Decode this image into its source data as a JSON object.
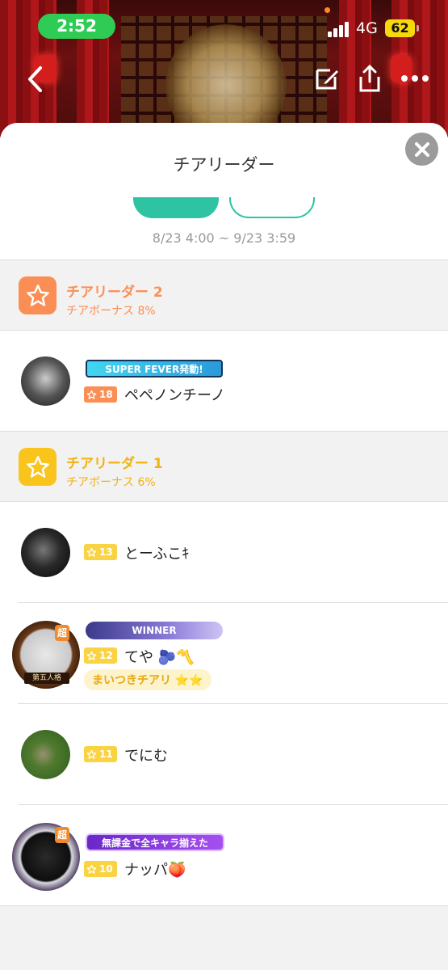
{
  "status_bar": {
    "time": "2:52",
    "network": "4G",
    "battery": "62"
  },
  "sheet": {
    "title": "チアリーダー",
    "tab_a_label": "",
    "tab_b_label": "",
    "period": "8/23 4:00 ~ 9/23 3:59"
  },
  "tiers": [
    {
      "name": "チアリーダー 2",
      "bonus": "チアボーナス 8%",
      "color": "#fb8e55",
      "members": [
        {
          "level": "18",
          "name": "ペペノンチーノ",
          "banner": "SUPER FEVER発動!"
        }
      ]
    },
    {
      "name": "チアリーダー 1",
      "bonus": "チアボーナス 6%",
      "color": "#f9c51d",
      "members": [
        {
          "level": "13",
          "name": "とーふこｷ"
        },
        {
          "level": "12",
          "name": "てや 🫐〽️",
          "banner": "WINNER",
          "chip": "まいつきチアリ ⭐⭐",
          "frame_badge": "超",
          "frame_text": "第五人格"
        },
        {
          "level": "11",
          "name": "でにむ"
        },
        {
          "level": "10",
          "name": "ナッパ🍑",
          "banner": "無課金で全キャラ揃えた",
          "frame_badge": "超"
        }
      ]
    }
  ],
  "icons": {
    "back": "chevron-left-icon",
    "edit": "edit-icon",
    "share": "share-icon",
    "more": "more-icon",
    "close": "close-icon",
    "star": "star-icon"
  }
}
